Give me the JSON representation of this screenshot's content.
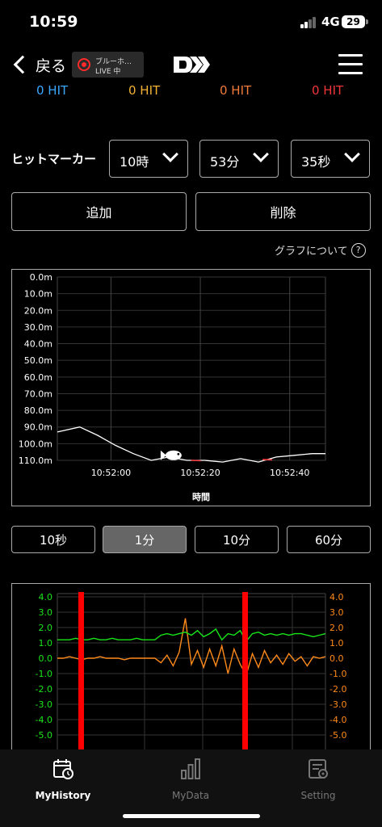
{
  "status_bar": {
    "time": "10:59",
    "network": "4G",
    "battery": "29"
  },
  "nav": {
    "back_label": "戻る",
    "live_title": "ブルーホ…",
    "live_label": "LIVE 中"
  },
  "hits": [
    {
      "label": "0 HIT",
      "color": "#3aa7ff"
    },
    {
      "label": "0 HIT",
      "color": "#f2b233"
    },
    {
      "label": "0 HIT",
      "color": "#f07a3a"
    },
    {
      "label": "0 HIT",
      "color": "#f0363a"
    }
  ],
  "hit_marker": {
    "label": "ヒットマーカー",
    "hour": "10時",
    "minute": "53分",
    "second": "35秒"
  },
  "actions": {
    "add": "追加",
    "delete": "削除"
  },
  "about_graph": "グラフについて",
  "depth_chart": {
    "xlabel": "時間",
    "y_ticks": [
      "0.0m",
      "10.0m",
      "20.0m",
      "30.0m",
      "40.0m",
      "50.0m",
      "60.0m",
      "70.0m",
      "80.0m",
      "90.0m",
      "100.0m",
      "110.0m"
    ],
    "x_ticks": [
      "10:52:00",
      "10:52:20",
      "10:52:40"
    ]
  },
  "ranges": [
    "10秒",
    "1分",
    "10分",
    "60分"
  ],
  "active_range": "1分",
  "sensor_chart": {
    "left_ticks": [
      "4.0",
      "3.0",
      "2.0",
      "1.0",
      "0.0",
      "-1.0",
      "-2.0",
      "-3.0",
      "-4.0",
      "-5.0"
    ],
    "right_ticks": [
      "4.0",
      "3.0",
      "2.0",
      "1.0",
      "0.0",
      "-1.0",
      "-2.0",
      "-3.0",
      "-4.0",
      "-5.0"
    ],
    "left_color": "#19e619",
    "right_color": "#ff8a1a"
  },
  "chart_data": [
    {
      "type": "line",
      "title": "",
      "xlabel": "時間",
      "ylabel": "",
      "ylim": [
        0,
        110
      ],
      "y_inverted": true,
      "x_ticks": [
        "10:52:00",
        "10:52:20",
        "10:52:40"
      ],
      "series": [
        {
          "x": [
            "10:51:48",
            "10:51:53",
            "10:51:57",
            "10:52:01",
            "10:52:05",
            "10:52:09",
            "10:52:13",
            "10:52:17",
            "10:52:21",
            "10:52:25",
            "10:52:29",
            "10:52:33",
            "10:52:37",
            "10:52:41",
            "10:52:45",
            "10:52:48"
          ],
          "values": [
            93,
            90,
            95,
            101,
            106,
            110,
            108,
            110,
            110,
            111,
            109,
            111,
            108,
            107,
            106,
            106
          ]
        }
      ]
    },
    {
      "type": "line",
      "title": "",
      "ylim": [
        -5,
        4
      ],
      "series": [
        {
          "values": [
            1.2,
            1.2,
            1.2,
            1.3,
            1.2,
            1.2,
            1.3,
            1.2,
            1.2,
            1.3,
            1.2,
            1.2,
            1.2,
            1.3,
            1.2,
            1.2,
            1.2,
            1.5,
            1.6,
            1.5,
            1.6,
            1.7,
            1.5,
            1.8,
            1.4,
            1.6,
            1.9,
            1.2,
            1.6,
            1.5,
            1.8,
            1.1,
            1.6,
            1.7,
            1.5,
            1.6,
            1.5,
            1.6,
            1.5,
            1.6,
            1.6,
            1.5,
            1.4,
            1.5,
            1.6
          ]
        },
        {
          "values": [
            0,
            0,
            0.1,
            0,
            -0.1,
            0,
            0,
            0.1,
            0,
            0,
            0,
            -0.1,
            0,
            0,
            0,
            0,
            0,
            -0.3,
            0.2,
            -0.5,
            0.4,
            2.6,
            -0.4,
            0.5,
            -0.6,
            0.6,
            -0.5,
            0.8,
            -1.0,
            0.6,
            -0.4,
            -1.1,
            0.3,
            -0.6,
            0.5,
            -0.3,
            0.2,
            -0.4,
            0.3,
            -0.2,
            0.1,
            -0.5,
            0.1,
            0,
            0.1
          ]
        }
      ]
    }
  ]
}
